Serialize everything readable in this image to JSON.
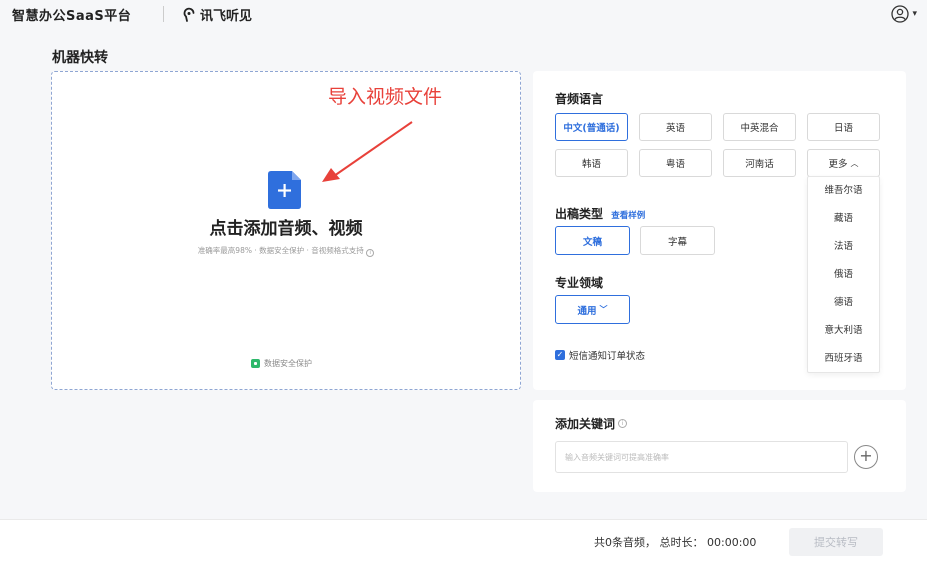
{
  "header": {
    "app_title": "智慧办公SaaS平台",
    "logo_text": "讯飞听见",
    "user_menu_icon": "user-circle-icon"
  },
  "page": {
    "title": "机器快转"
  },
  "upload": {
    "annotation": "导入视频文件",
    "title": "点击添加音频、视频",
    "subtitle": "准确率最高98% · 数据安全保护 · 音视频格式支持",
    "secure_text": "数据安全保护",
    "file_icon": "file-plus-icon"
  },
  "settings": {
    "language_label": "音频语言",
    "languages": [
      "中文(普通话)",
      "英语",
      "中英混合",
      "日语",
      "韩语",
      "粤语",
      "河南话"
    ],
    "more_label": "更多",
    "more_options": [
      "维吾尔语",
      "藏语",
      "法语",
      "俄语",
      "德语",
      "意大利语",
      "西班牙语"
    ],
    "output_type_label": "出稿类型",
    "sample_link": "查看样例",
    "output_types": [
      "文稿",
      "字幕"
    ],
    "domain_label": "专业领域",
    "domain_value": "通用",
    "sms_label": "短信通知订单状态",
    "sms_checked": true
  },
  "keywords": {
    "label": "添加关键词",
    "placeholder": "输入音频关键词可提高准确率"
  },
  "footer": {
    "summary": "共0条音频， 总时长： 00:00:00",
    "submit_label": "提交转写"
  },
  "colors": {
    "accent": "#2f6fdd",
    "annotation": "#e8413a",
    "secure_green": "#2db86a"
  }
}
